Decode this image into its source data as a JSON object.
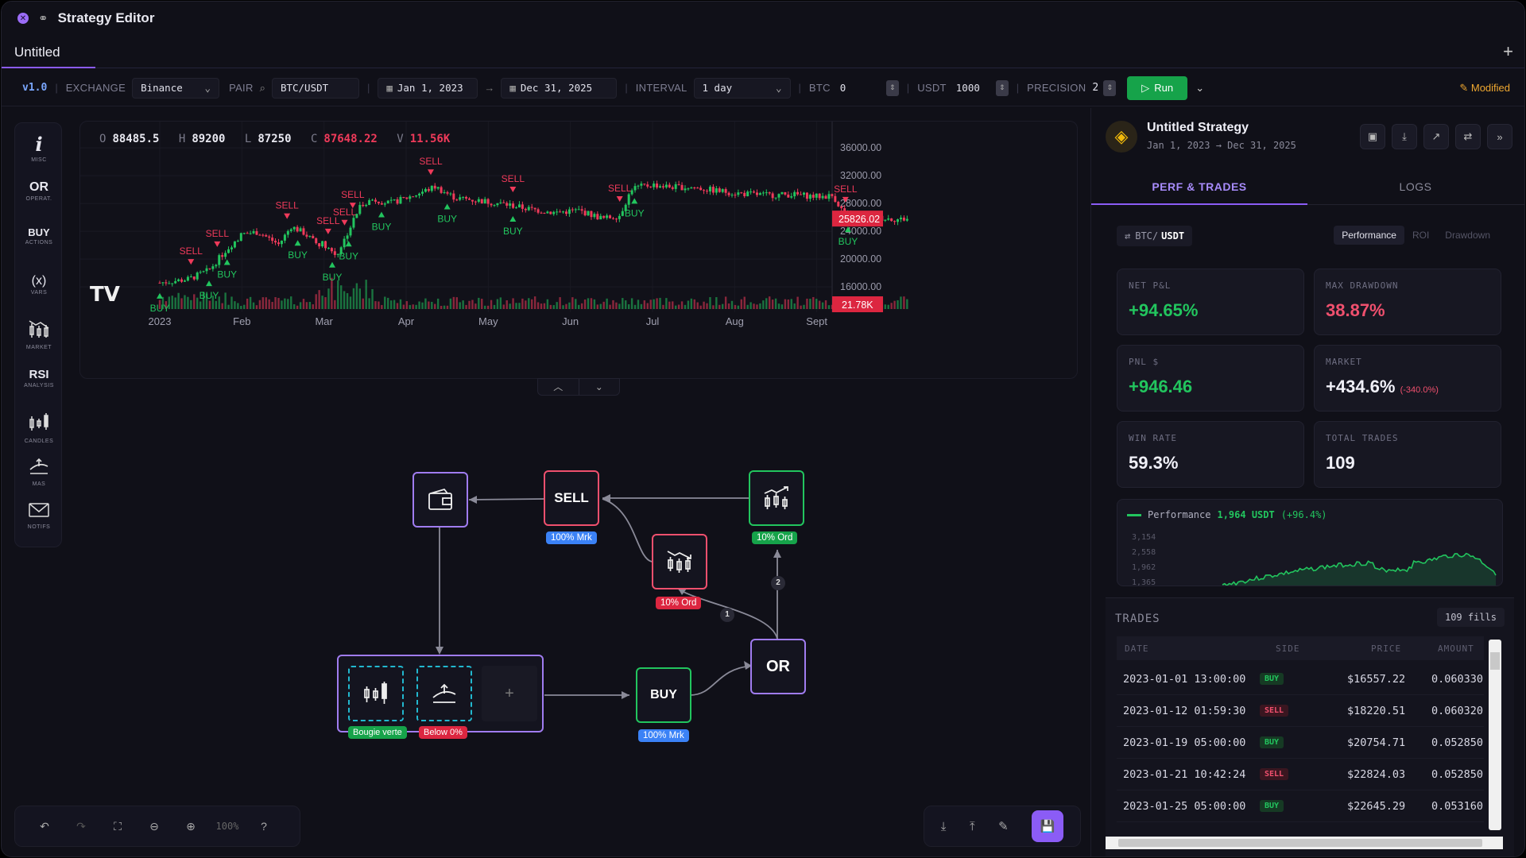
{
  "window": {
    "title": "Strategy Editor"
  },
  "tabs": [
    {
      "label": "Untitled"
    }
  ],
  "toolbar": {
    "version": "v1.0",
    "exchange_label": "EXCHANGE",
    "exchange_value": "Binance",
    "pair_label": "PAIR",
    "pair_value": "BTC/USDT",
    "start_date": "Jan 1, 2023",
    "end_date": "Dec 31, 2025",
    "interval_label": "INTERVAL",
    "interval_value": "1 day",
    "btc_label": "BTC",
    "btc_value": "0",
    "usdt_label": "USDT",
    "usdt_value": "1000",
    "precision_label": "PRECISION",
    "precision_value": "2",
    "run_label": "Run",
    "status": "Modified"
  },
  "sidebar": [
    {
      "title": "i",
      "caption": "MISC",
      "icon": "info-icon"
    },
    {
      "title": "OR",
      "caption": "OPERAT.",
      "icon": ""
    },
    {
      "title": "BUY",
      "caption": "ACTIONS",
      "icon": ""
    },
    {
      "title": "(x)",
      "caption": "VARS",
      "icon": "variables-icon"
    },
    {
      "title": "",
      "caption": "MARKET",
      "icon": "market-icon"
    },
    {
      "title": "RSI",
      "caption": "ANALYSIS",
      "icon": ""
    },
    {
      "title": "",
      "caption": "CANDLES",
      "icon": "candles-icon"
    },
    {
      "title": "",
      "caption": "MAS",
      "icon": "moving-average-icon"
    },
    {
      "title": "",
      "caption": "NOTIFS",
      "icon": "mail-icon"
    }
  ],
  "chart": {
    "ohlc": {
      "o_label": "O",
      "o": "88485.5",
      "h_label": "H",
      "h": "89200",
      "l_label": "L",
      "l": "87250",
      "c_label": "C",
      "c": "87648.22",
      "v_label": "V",
      "v": "11.56K"
    },
    "last_price": "25826.02",
    "last_volume": "21.78K",
    "brand": "TV"
  },
  "chart_data": {
    "type": "candlestick",
    "x_ticks": [
      "2023",
      "Feb",
      "Mar",
      "Apr",
      "May",
      "Jun",
      "Jul",
      "Aug",
      "Sept"
    ],
    "y_ticks": [
      36000,
      32000,
      28000,
      24000,
      20000,
      16000
    ],
    "ylim": [
      13500,
      37500
    ],
    "price_path": [
      [
        0,
        16600
      ],
      [
        0.35,
        17100
      ],
      [
        0.6,
        18400
      ],
      [
        0.8,
        21200
      ],
      [
        1.0,
        23600
      ],
      [
        1.2,
        23900
      ],
      [
        1.45,
        22100
      ],
      [
        1.6,
        24700
      ],
      [
        1.75,
        23800
      ],
      [
        1.9,
        22300
      ],
      [
        2.0,
        22200
      ],
      [
        2.15,
        20500
      ],
      [
        2.3,
        24100
      ],
      [
        2.45,
        27900
      ],
      [
        2.6,
        28600
      ],
      [
        2.8,
        28000
      ],
      [
        3.1,
        29200
      ],
      [
        3.35,
        30400
      ],
      [
        3.6,
        28800
      ],
      [
        3.9,
        28400
      ],
      [
        4.2,
        27900
      ],
      [
        4.5,
        27200
      ],
      [
        4.8,
        26700
      ],
      [
        5.1,
        27000
      ],
      [
        5.4,
        25800
      ],
      [
        5.6,
        26300
      ],
      [
        5.75,
        30200
      ],
      [
        6.0,
        30700
      ],
      [
        6.2,
        30400
      ],
      [
        6.5,
        30300
      ],
      [
        6.8,
        29800
      ],
      [
        7.1,
        29400
      ],
      [
        7.4,
        29200
      ],
      [
        7.7,
        29300
      ],
      [
        8.0,
        29000
      ],
      [
        8.2,
        29100
      ],
      [
        8.35,
        26200
      ],
      [
        8.6,
        26000
      ],
      [
        8.8,
        25900
      ],
      [
        9.0,
        25700
      ],
      [
        9.1,
        25800
      ]
    ],
    "signals": [
      {
        "x": 0.0,
        "side": "BUY",
        "label": "BUY"
      },
      {
        "x": 0.38,
        "side": "SELL",
        "label": "SELL"
      },
      {
        "x": 0.6,
        "side": "BUY",
        "label": "BUY"
      },
      {
        "x": 0.7,
        "side": "SELL",
        "label": "SELL"
      },
      {
        "x": 0.82,
        "side": "BUY",
        "label": "BUY"
      },
      {
        "x": 1.55,
        "side": "SELL",
        "label": "SELL"
      },
      {
        "x": 1.68,
        "side": "BUY",
        "label": "BUY"
      },
      {
        "x": 2.05,
        "side": "SELL",
        "label": "SELL"
      },
      {
        "x": 2.1,
        "side": "BUY",
        "label": "BUY"
      },
      {
        "x": 2.25,
        "side": "SELL",
        "label": "SELL"
      },
      {
        "x": 2.3,
        "side": "BUY",
        "label": "BUY"
      },
      {
        "x": 2.35,
        "side": "SELL",
        "label": "SELL"
      },
      {
        "x": 2.7,
        "side": "BUY",
        "label": "BUY"
      },
      {
        "x": 3.3,
        "side": "SELL",
        "label": "SELL"
      },
      {
        "x": 3.5,
        "side": "BUY",
        "label": "BUY"
      },
      {
        "x": 4.3,
        "side": "SELL",
        "label": "SELL"
      },
      {
        "x": 4.3,
        "side": "BUY",
        "label": "BUY"
      },
      {
        "x": 5.6,
        "side": "SELL",
        "label": "SELL"
      },
      {
        "x": 5.78,
        "side": "BUY",
        "label": "BUY"
      },
      {
        "x": 8.35,
        "side": "SELL",
        "label": "SELL"
      },
      {
        "x": 8.38,
        "side": "BUY",
        "label": "BUY"
      }
    ],
    "colors": {
      "up": "#22c55e",
      "down": "#ef3a5a"
    }
  },
  "canvas": {
    "nodes": {
      "sell": {
        "label": "SELL",
        "badge": "100% Mrk"
      },
      "market_up": {
        "badge": "10% Ord"
      },
      "market_down": {
        "badge": "10% Ord"
      },
      "or": {
        "label": "OR"
      },
      "buy": {
        "label": "BUY",
        "badge": "100% Mrk"
      },
      "group_candles_badge": "Bougie verte",
      "group_ma_badge": "Below 0%",
      "edge_1": "1",
      "edge_2": "2"
    }
  },
  "zoom": {
    "level": "100%"
  },
  "panel": {
    "strategy_name": "Untitled Strategy",
    "date_range": "Jan 1, 2023 → Dec 31, 2025",
    "tabs": [
      "PERF & TRADES",
      "LOGS"
    ],
    "pair_base": "BTC",
    "pair_quote": "USDT",
    "view_tabs": [
      "Performance",
      "ROI",
      "Drawdown"
    ],
    "metrics": {
      "net_pnl_label": "NET P&L",
      "net_pnl": "+94.65%",
      "max_dd_label": "MAX DRAWDOWN",
      "max_dd": "38.87%",
      "pnl_usd_label": "PNL $",
      "pnl_usd": "+946.46",
      "market_label": "MARKET",
      "market": "+434.6%",
      "market_delta": "(-340.0%)",
      "win_rate_label": "WIN RATE",
      "win_rate": "59.3%",
      "total_trades_label": "TOTAL TRADES",
      "total_trades": "109"
    },
    "performance": {
      "label": "Performance",
      "value": "1,964 USDT",
      "pct": "(+96.4%)",
      "y_ticks": [
        "3,154",
        "2,558",
        "1,962",
        "1,365"
      ]
    },
    "trades": {
      "title": "TRADES",
      "fills": "109 fills",
      "columns": [
        "DATE",
        "SIDE",
        "PRICE",
        "AMOUNT"
      ],
      "rows": [
        {
          "date": "2023-01-01 13:00:00",
          "side": "BUY",
          "price": "$16557.22",
          "amount": "0.060330"
        },
        {
          "date": "2023-01-12 01:59:30",
          "side": "SELL",
          "price": "$18220.51",
          "amount": "0.060320"
        },
        {
          "date": "2023-01-19 05:00:00",
          "side": "BUY",
          "price": "$20754.71",
          "amount": "0.052850"
        },
        {
          "date": "2023-01-21 10:42:24",
          "side": "SELL",
          "price": "$22824.03",
          "amount": "0.052850"
        },
        {
          "date": "2023-01-25 05:00:00",
          "side": "BUY",
          "price": "$22645.29",
          "amount": "0.053160"
        }
      ]
    }
  }
}
